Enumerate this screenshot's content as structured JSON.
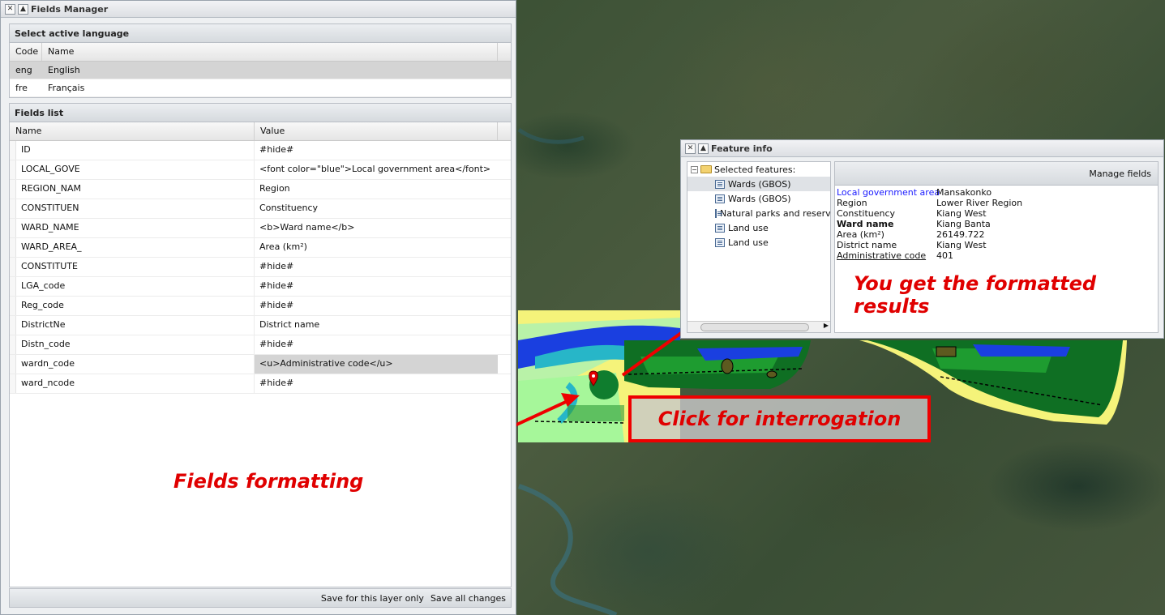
{
  "fields_manager": {
    "title": "Fields Manager",
    "language_section": "Select active language",
    "language_columns": {
      "code": "Code",
      "name": "Name"
    },
    "languages": [
      {
        "code": "eng",
        "name": "English",
        "selected": true
      },
      {
        "code": "fre",
        "name": "Français",
        "selected": false
      }
    ],
    "fields_section": "Fields list",
    "field_columns": {
      "name": "Name",
      "value": "Value"
    },
    "fields": [
      {
        "name": "ID",
        "value": "#hide#"
      },
      {
        "name": "LOCAL_GOVE",
        "value": "<font color=\"blue\">Local government area</font>"
      },
      {
        "name": "REGION_NAM",
        "value": "Region"
      },
      {
        "name": "CONSTITUEN",
        "value": "Constituency"
      },
      {
        "name": "WARD_NAME",
        "value": "<b>Ward name</b>"
      },
      {
        "name": "WARD_AREA_",
        "value": "Area (km²)"
      },
      {
        "name": "CONSTITUTE",
        "value": "#hide#"
      },
      {
        "name": "LGA_code",
        "value": "#hide#"
      },
      {
        "name": "Reg_code",
        "value": "#hide#"
      },
      {
        "name": "DistrictNe",
        "value": "District name"
      },
      {
        "name": "Distn_code",
        "value": "#hide#"
      },
      {
        "name": "wardn_code",
        "value": "<u>Administrative code</u>",
        "selected": true
      },
      {
        "name": "ward_ncode",
        "value": "#hide#"
      }
    ],
    "save_layer_label": "Save for this layer only",
    "save_all_label": "Save all changes"
  },
  "feature_info": {
    "title": "Feature info",
    "tree_root": "Selected features:",
    "tree_items": [
      {
        "label": "Wards (GBOS)",
        "selected": true
      },
      {
        "label": "Wards (GBOS)",
        "selected": false
      },
      {
        "label": "Natural parks and reserves",
        "selected": false
      },
      {
        "label": "Land use",
        "selected": false
      },
      {
        "label": "Land use",
        "selected": false
      }
    ],
    "manage_fields_label": "Manage fields",
    "attributes": [
      {
        "key": "Local government area",
        "value": "Mansakonko",
        "style": "blue"
      },
      {
        "key": "Region",
        "value": "Lower River Region",
        "style": "plain"
      },
      {
        "key": "Constituency",
        "value": "Kiang West",
        "style": "plain"
      },
      {
        "key": "Ward name",
        "value": "Kiang Banta",
        "style": "bold"
      },
      {
        "key": "Area (km²)",
        "value": "26149.722",
        "style": "plain"
      },
      {
        "key": "District name",
        "value": "Kiang West",
        "style": "plain"
      },
      {
        "key": "Administrative code",
        "value": "401",
        "style": "underline"
      }
    ]
  },
  "annotations": {
    "formatted_results": "You get the formatted results",
    "click_interrogation": "Click for interrogation",
    "fields_formatting": "Fields formatting"
  },
  "colors": {
    "annotation_red": "#e00000",
    "selected_row": "#d4d4d4",
    "link_blue": "#1a1aff"
  }
}
